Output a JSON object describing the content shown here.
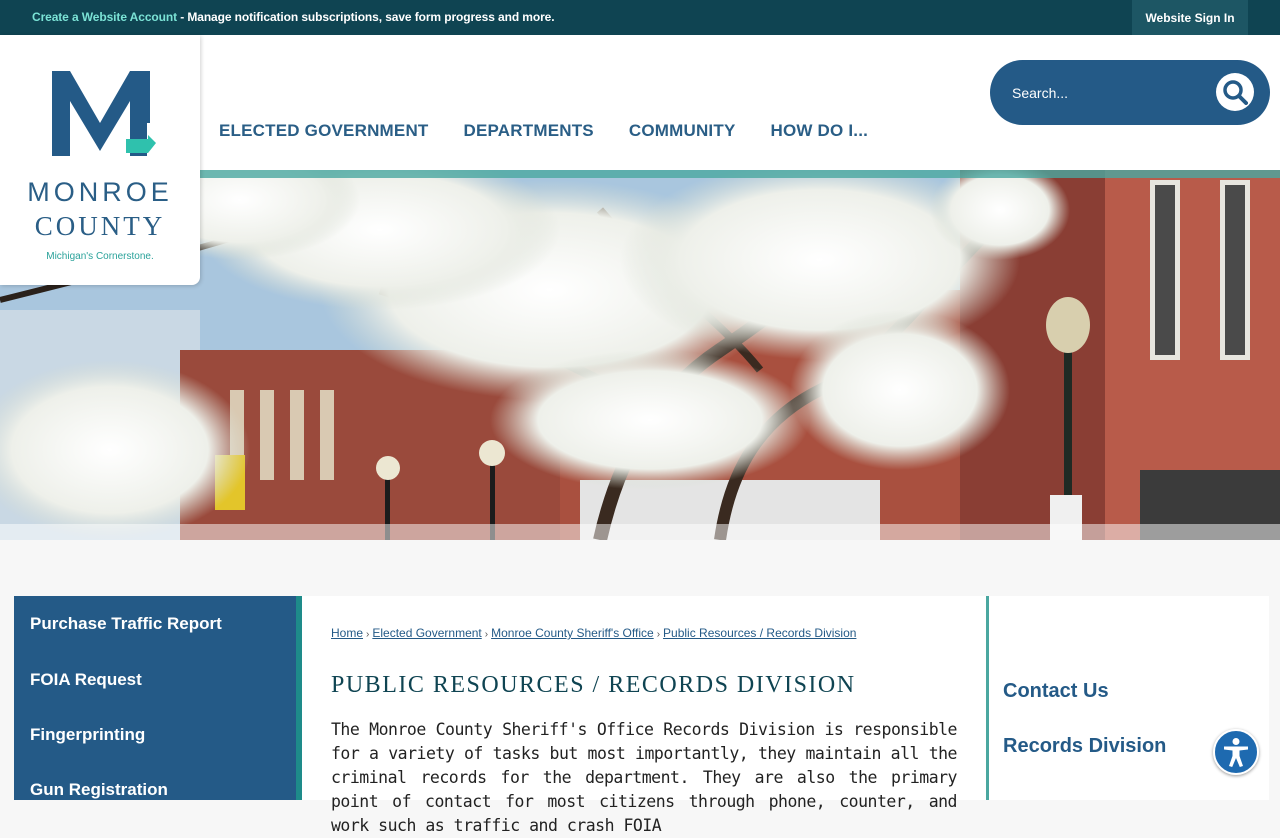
{
  "top_bar": {
    "create_account_link": "Create a Website Account",
    "message": " - Manage notification subscriptions, save form progress and more.",
    "sign_in": "Website Sign In"
  },
  "logo": {
    "line1": "MONROE",
    "line2": "COUNTY",
    "tagline": "Michigan's Cornerstone."
  },
  "nav": {
    "items": [
      "ELECTED GOVERNMENT",
      "DEPARTMENTS",
      "COMMUNITY",
      "HOW DO I..."
    ]
  },
  "search": {
    "placeholder": "Search..."
  },
  "sidebar": {
    "items": [
      "Purchase Traffic Report",
      "FOIA Request",
      "Fingerprinting",
      "Gun Registration"
    ]
  },
  "breadcrumb": [
    "Home",
    "Elected Government",
    "Monroe County Sheriff's Office",
    "Public Resources / Records Division"
  ],
  "page": {
    "title": "PUBLIC RESOURCES / RECORDS DIVISION",
    "body": "The Monroe County Sheriff's Office Records Division is responsible for a variety of tasks but most importantly, they maintain all the criminal records for the department. They are also the primary point of contact for most citizens through phone, counter, and work such as traffic and crash FOIA"
  },
  "right_panel": {
    "links": [
      "Contact Us",
      "Records Division"
    ]
  },
  "colors": {
    "top_bar": "#0f4452",
    "primary_blue": "#245a87",
    "accent_teal": "#4aa7a0"
  },
  "icons": {
    "search": "search-icon",
    "accessibility": "accessibility-icon"
  }
}
